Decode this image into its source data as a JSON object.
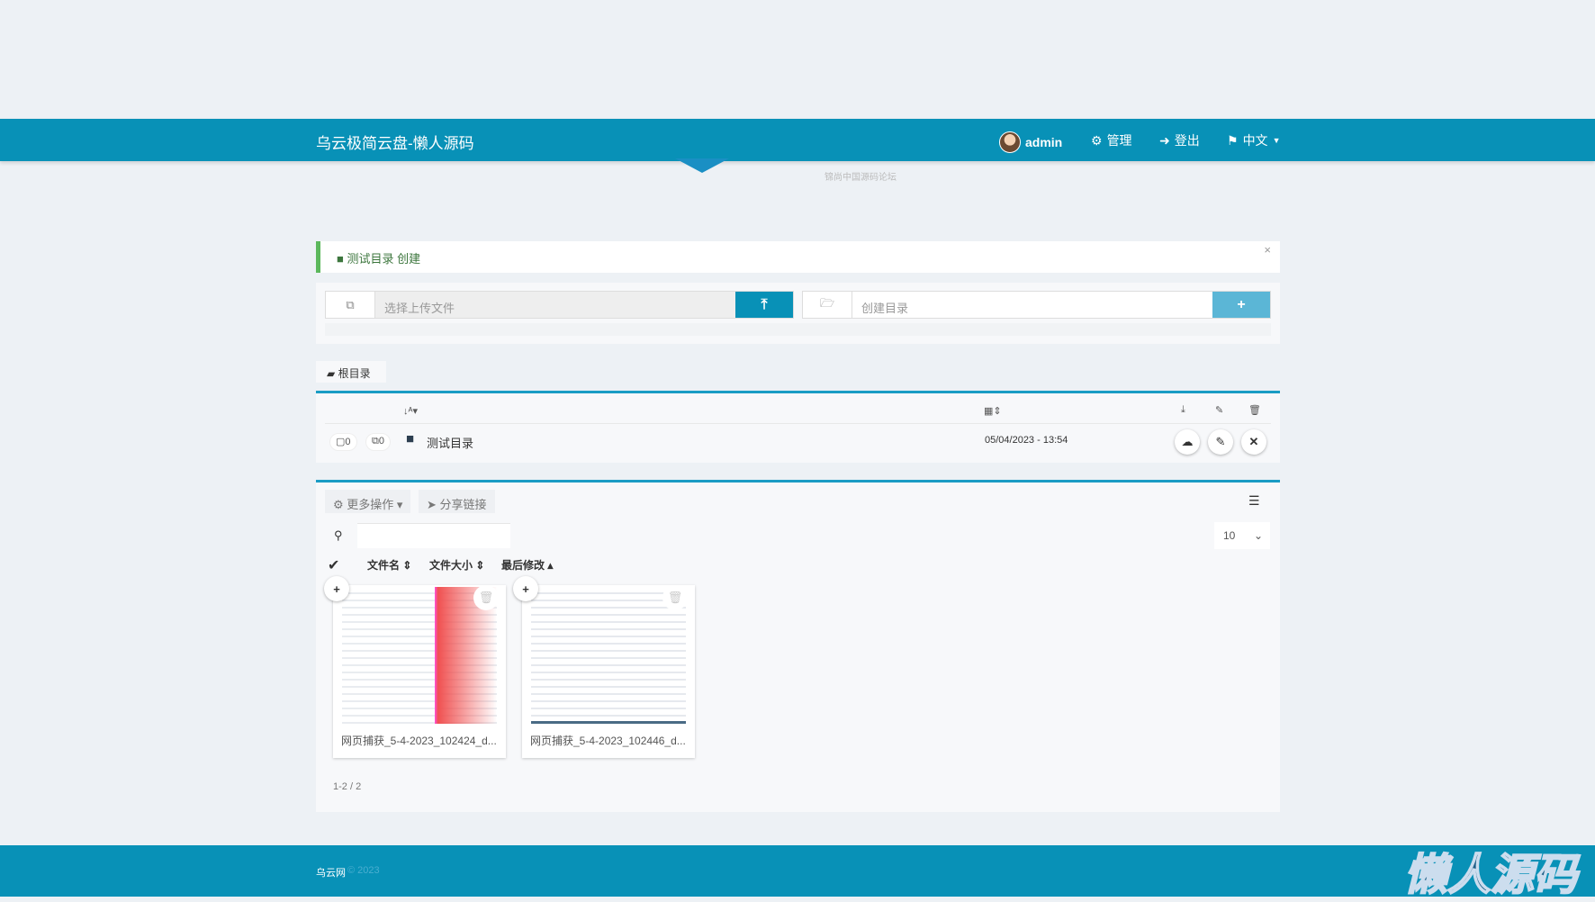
{
  "nav": {
    "brand": "乌云极简云盘-懒人源码",
    "user": "admin",
    "manage": "管理",
    "logout": "登出",
    "lang": "中文"
  },
  "logo": {
    "subtitle": "锦尚中国源码论坛"
  },
  "alert": {
    "folder": "测试目录",
    "action": "创建",
    "close": "×"
  },
  "upload": {
    "placeholder": "选择上传文件",
    "mkdir_placeholder": "创建目录"
  },
  "breadcrumb": {
    "root": "根目录"
  },
  "folders": [
    {
      "name": "测试目录",
      "dirs": "0",
      "files": "0",
      "date": "05/04/2023 - 13:54"
    }
  ],
  "files": {
    "more_actions": "更多操作",
    "share_link": "分享链接",
    "per_page": "10",
    "col_name": "文件名",
    "col_size": "文件大小",
    "col_modified": "最后修改",
    "items": [
      {
        "name": "网页捕获_5-4-2023_102424_d..."
      },
      {
        "name": "网页捕获_5-4-2023_102446_d..."
      }
    ],
    "pagination": "1-2 / 2"
  },
  "footer": {
    "site": "乌云网",
    "copy": "© 2023"
  },
  "watermark": "懒人源码",
  "colors": {
    "primary": "#0891b7",
    "success": "#5cb85c"
  }
}
